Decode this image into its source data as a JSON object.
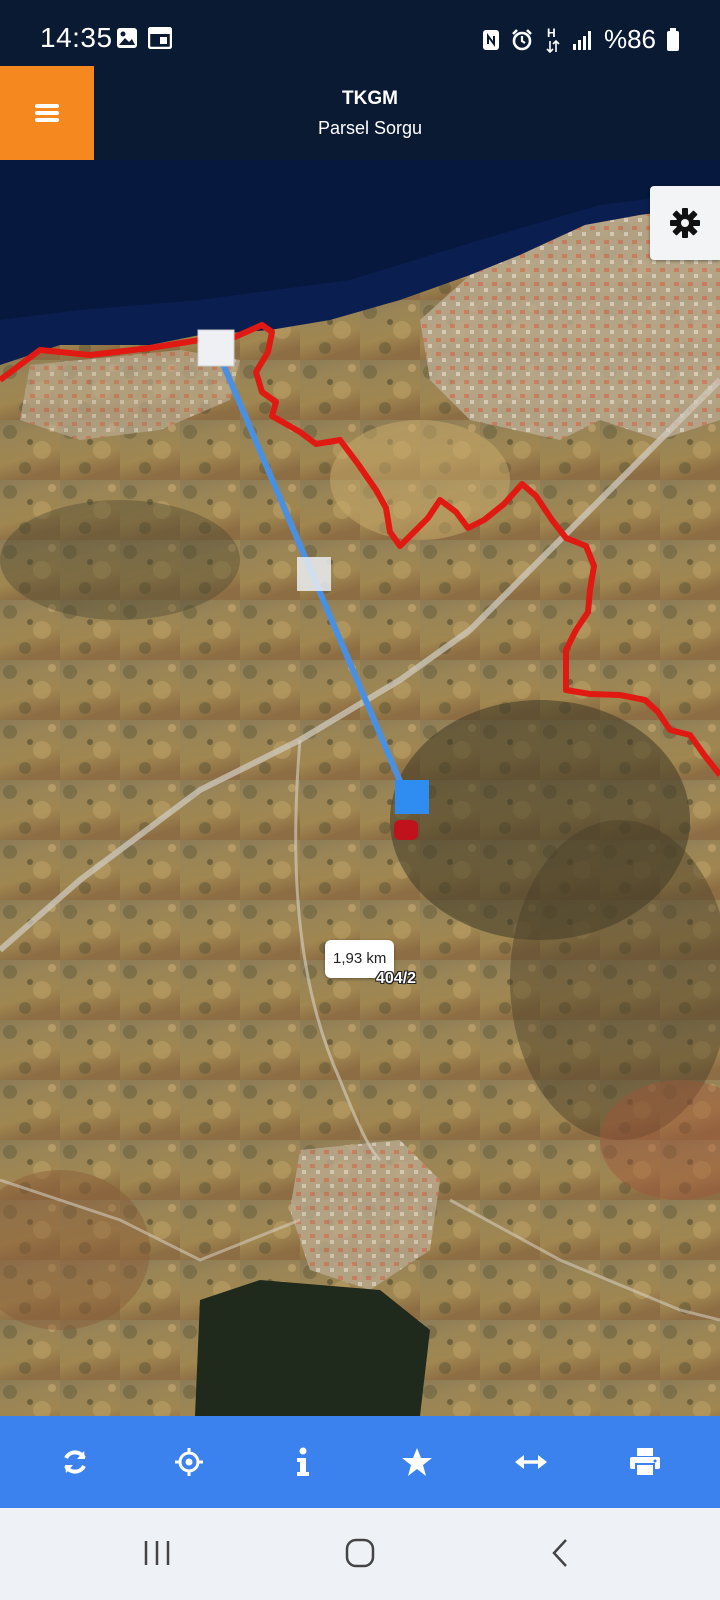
{
  "status_bar": {
    "time": "14:35",
    "battery": "%86",
    "icons": [
      "gallery-icon",
      "calendar-icon",
      "nfc-icon",
      "alarm-icon",
      "network-h-icon",
      "signal-icon",
      "battery-icon"
    ]
  },
  "header": {
    "title": "TKGM",
    "subtitle": "Parsel Sorgu",
    "menu_icon": "hamburger-menu-icon",
    "accent_color": "#f5891f",
    "background_color": "#0b1a33"
  },
  "map": {
    "distance_label": "1,93 km",
    "parcel_label": "404/2",
    "boundary_color": "#e01a12",
    "measure_line_color": "#4a90e2"
  },
  "toolbar": {
    "background_color": "#3b82ee",
    "buttons": [
      "refresh-icon",
      "locate-icon",
      "info-icon",
      "favorite-star-icon",
      "measure-icon",
      "print-icon"
    ]
  },
  "nav_bar": {
    "buttons": [
      "recent-apps-icon",
      "home-icon",
      "back-icon"
    ]
  }
}
